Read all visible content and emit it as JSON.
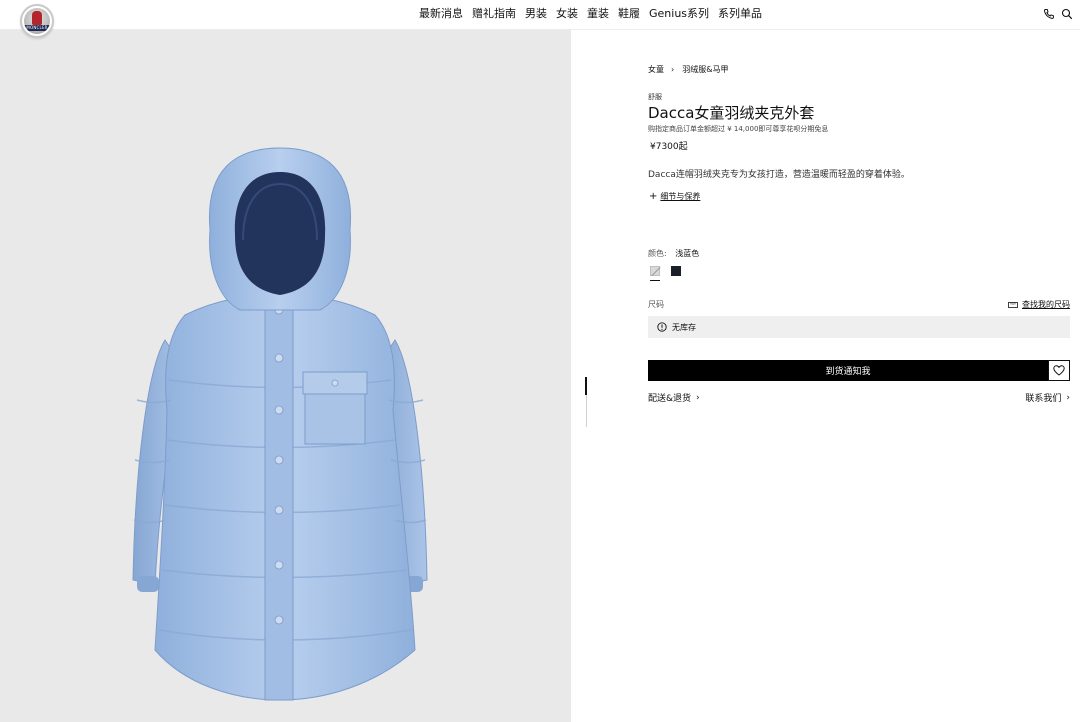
{
  "header": {
    "logo_text": "MONCLER",
    "nav": [
      "最新消息",
      "赠礼指南",
      "男装",
      "女装",
      "童装",
      "鞋履",
      "Genius系列",
      "系列单品"
    ],
    "icons": [
      "phone-icon",
      "search-icon"
    ]
  },
  "product": {
    "breadcrumb": [
      "女童",
      "羽绒服&马甲"
    ],
    "badge": "舒服",
    "title": "Dacca女童羽绒夹克外套",
    "promo": "购指定商品订单金额超过 ¥ 14,000即可尊享花呗分期免息",
    "price": "¥7300起",
    "description": "Dacca连帽羽绒夹克专为女孩打造，营造温暖而轻盈的穿着体验。",
    "details_link": "细节与保养",
    "color_label": "颜色:",
    "color_value": "浅蓝色",
    "swatches": [
      {
        "name": "浅蓝色",
        "color": "#d9d9d9",
        "selected": true
      },
      {
        "name": "navy",
        "color": "#1b1f2a",
        "selected": false
      }
    ],
    "size_label": "尺码",
    "size_guide": "查找我的尺码",
    "stock_status": "无库存",
    "notify_button": "到货通知我",
    "shipping_link": "配送&退货",
    "contact_link": "联系我们"
  },
  "colors": {
    "coat": "#a9c3e6",
    "background_image": "#e9e9e9",
    "button": "#000000"
  }
}
